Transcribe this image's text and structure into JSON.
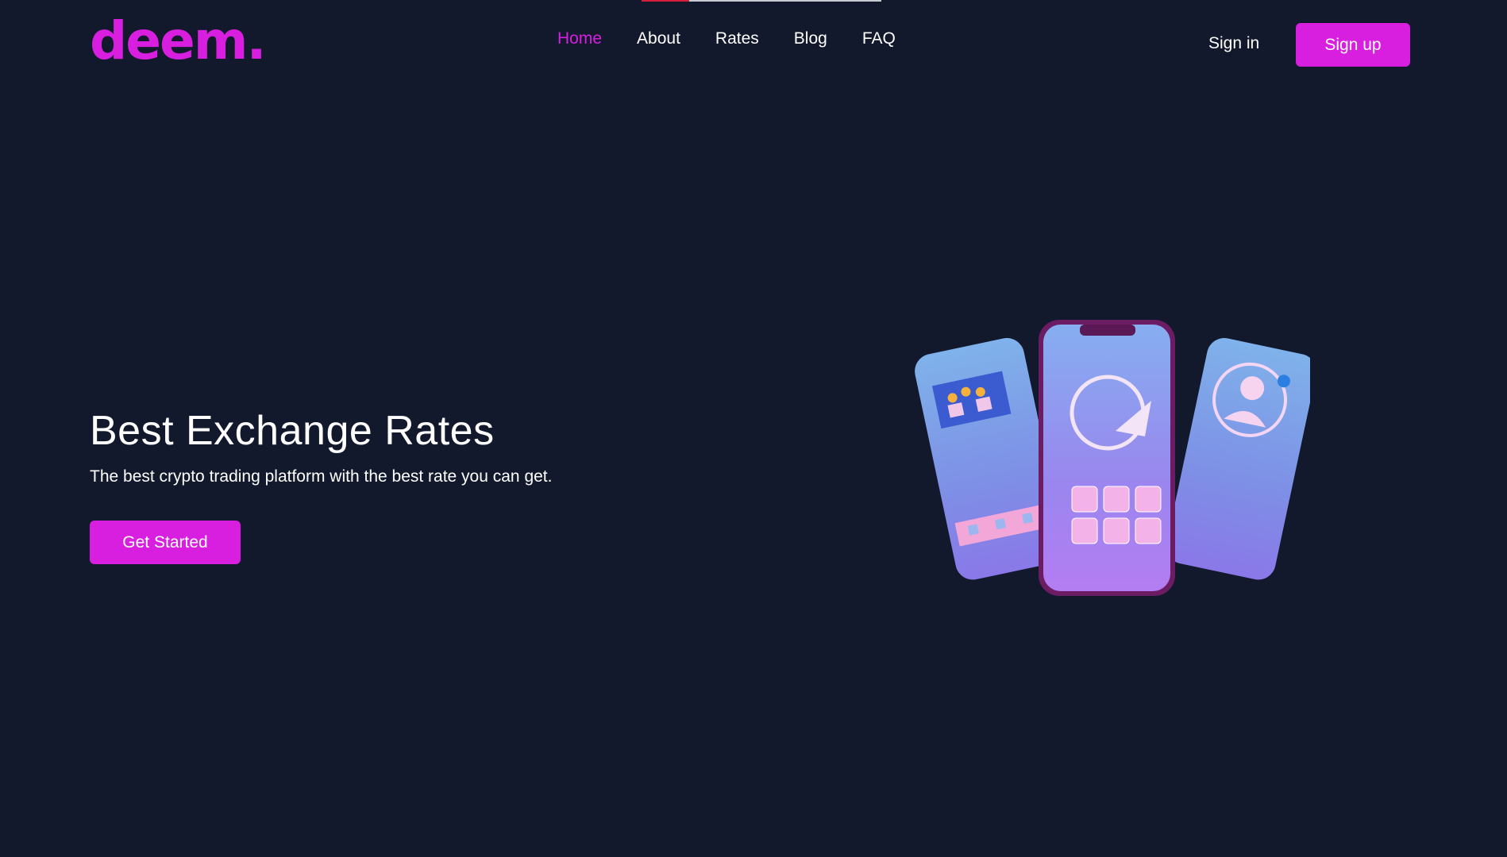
{
  "brand": {
    "logo_text": "deem."
  },
  "nav": {
    "items": [
      {
        "label": "Home",
        "active": true
      },
      {
        "label": "About",
        "active": false
      },
      {
        "label": "Rates",
        "active": false
      },
      {
        "label": "Blog",
        "active": false
      },
      {
        "label": "FAQ",
        "active": false
      }
    ]
  },
  "auth": {
    "sign_in_label": "Sign in",
    "sign_up_label": "Sign up"
  },
  "hero": {
    "title": "Best Exchange Rates",
    "subtitle": "The best crypto trading platform with the best rate you can get.",
    "cta_label": "Get Started",
    "illustration_icon": "three-phones-app-illustration-icon"
  },
  "colors": {
    "background": "#13192c",
    "accent": "#d81fe0",
    "text": "#ffffff"
  }
}
